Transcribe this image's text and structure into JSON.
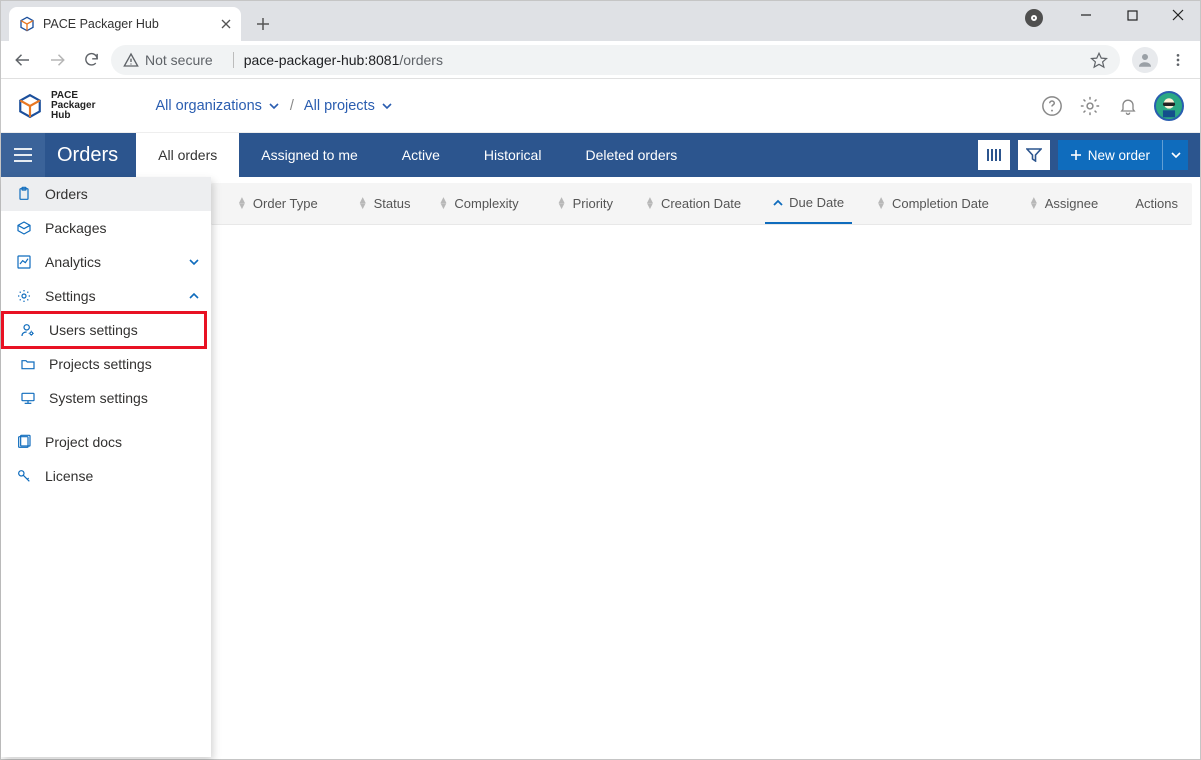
{
  "window": {
    "tab_title": "PACE Packager Hub"
  },
  "addressbar": {
    "security_label": "Not secure",
    "url_host": "pace-packager-hub:8081",
    "url_path": "/orders"
  },
  "appheader": {
    "logo_line1": "PACE",
    "logo_line2": "Packager",
    "logo_line3": "Hub",
    "crumb_org": "All organizations",
    "crumb_sep": "/",
    "crumb_proj": "All projects"
  },
  "navbar": {
    "title": "Orders",
    "tabs": [
      "All orders",
      "Assigned to me",
      "Active",
      "Historical",
      "Deleted orders"
    ],
    "new_order_label": "New order"
  },
  "sidemenu": {
    "orders": "Orders",
    "packages": "Packages",
    "analytics": "Analytics",
    "settings": "Settings",
    "users_settings": "Users settings",
    "projects_settings": "Projects settings",
    "system_settings": "System settings",
    "project_docs": "Project docs",
    "license": "License"
  },
  "table": {
    "columns": [
      "Order Type",
      "Status",
      "Complexity",
      "Priority",
      "Creation Date",
      "Due Date",
      "Completion Date",
      "Assignee",
      "Actions"
    ]
  }
}
